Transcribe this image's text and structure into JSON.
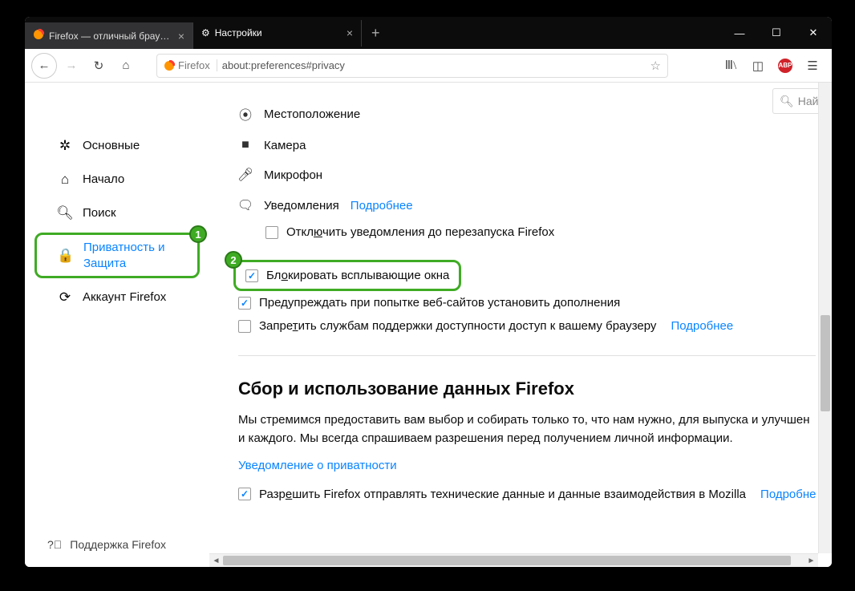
{
  "tabs": {
    "inactive": "Firefox — отличный браузер д",
    "active": "Настройки"
  },
  "url": {
    "brand": "Firefox",
    "address": "about:preferences#privacy"
  },
  "search_placeholder": "Най",
  "sidebar": {
    "items": [
      {
        "icon": "gear",
        "label": "Основные"
      },
      {
        "icon": "home",
        "label": "Начало"
      },
      {
        "icon": "search",
        "label": "Поиск"
      },
      {
        "icon": "lock",
        "label": "Приватность и Защита"
      },
      {
        "icon": "sync",
        "label": "Аккаунт Firefox"
      }
    ],
    "support": "Поддержка Firefox"
  },
  "permissions": {
    "location": "Местоположение",
    "camera": "Камера",
    "microphone": "Микрофон",
    "notifications": "Уведомления",
    "more": "Подробнее",
    "disable_notifs": "Отключить уведомления до перезапуска Firefox"
  },
  "options": {
    "block_popups": "Блокировать всплывающие окна",
    "warn_addons": "Предупреждать при попытке веб-сайтов установить дополнения",
    "deny_a11y": "Запретить службам поддержки доступности доступ к вашему браузеру",
    "more": "Подробнее"
  },
  "data": {
    "heading": "Сбор и использование данных Firefox",
    "para": "Мы стремимся предоставить вам выбор и собирать только то, что нам нужно, для выпуска и улучшен и каждого. Мы всегда спрашиваем разрешения перед получением личной информации.",
    "privacy_link": "Уведомление о приватности",
    "telemetry": "Разрешить Firefox отправлять технические данные и данные взаимодействия в Mozilla",
    "more": "Подробне"
  },
  "annotations": {
    "one": "1",
    "two": "2"
  }
}
